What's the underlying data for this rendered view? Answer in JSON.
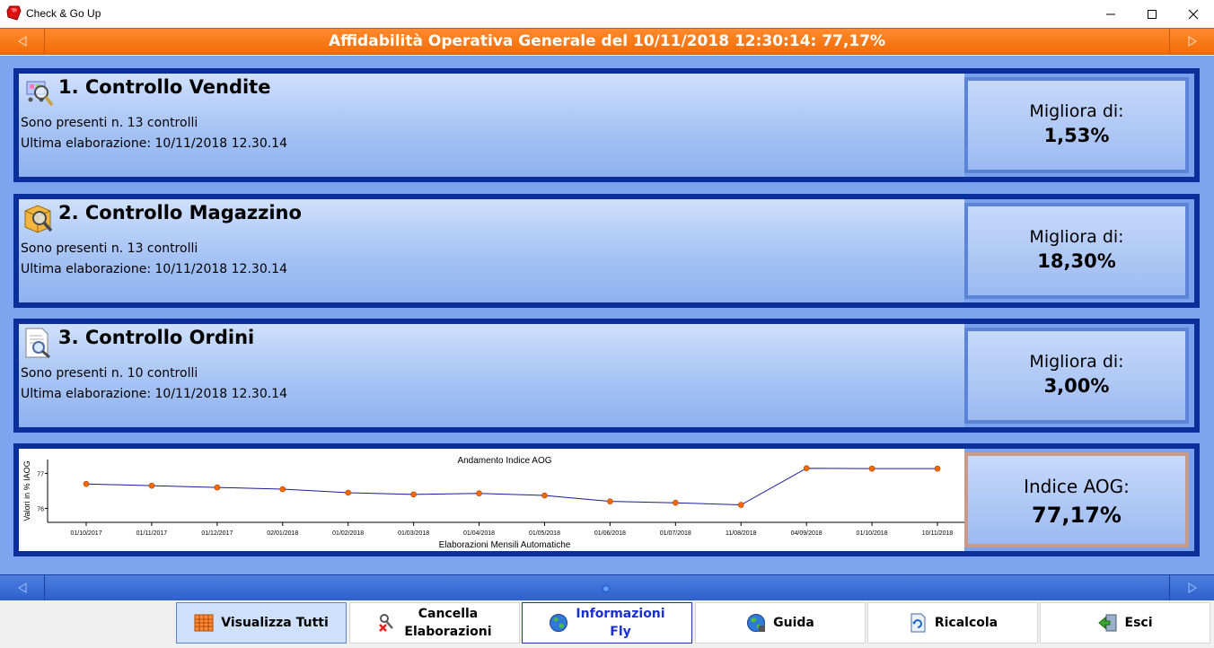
{
  "window": {
    "title": "Check & Go Up"
  },
  "banner": {
    "text": "Affidabilità Operativa Generale del 10/11/2018 12:30:14: 77,17%"
  },
  "panels": [
    {
      "title": "1. Controllo Vendite",
      "count_text": "Sono presenti n. 13 controlli",
      "last_text": "Ultima elaborazione: 10/11/2018 12.30.14",
      "score_label": "Migliora di:",
      "score_value": "1,53%",
      "icon": "cart-magnifier-icon"
    },
    {
      "title": "2. Controllo Magazzino",
      "count_text": "Sono presenti n. 13 controlli",
      "last_text": "Ultima elaborazione: 10/11/2018 12.30.14",
      "score_label": "Migliora di:",
      "score_value": "18,30%",
      "icon": "box-magnifier-icon"
    },
    {
      "title": "3. Controllo Ordini",
      "count_text": "Sono presenti n. 10 controlli",
      "last_text": "Ultima elaborazione: 10/11/2018 12.30.14",
      "score_label": "Migliora di:",
      "score_value": "3,00%",
      "icon": "document-magnifier-icon"
    }
  ],
  "aog": {
    "label": "Indice AOG:",
    "value": "77,17%"
  },
  "chart_data": {
    "type": "line",
    "title": "Andamento Indice AOG",
    "xlabel": "Elaborazioni Mensili Automatiche",
    "ylabel": "Valori in % IAOG",
    "categories": [
      "01/10/2017",
      "01/11/2017",
      "01/12/2017",
      "02/01/2018",
      "01/02/2018",
      "01/03/2018",
      "01/04/2018",
      "01/05/2018",
      "01/06/2018",
      "01/07/2018",
      "11/08/2018",
      "04/09/2018",
      "01/10/2018",
      "10/11/2018"
    ],
    "yticks": [
      76,
      77
    ],
    "ylim": [
      75.6,
      77.4
    ],
    "series": [
      {
        "values": [
          76.7,
          76.65,
          76.6,
          76.55,
          76.45,
          76.4,
          76.43,
          76.37,
          76.2,
          76.16,
          76.1,
          77.15,
          77.14,
          77.14
        ]
      }
    ],
    "line_color": "#1a1a9a",
    "marker_color": "#ff6a00",
    "grid": false
  },
  "toolbar": [
    {
      "label": "Visualizza Tutti",
      "icon": "calendar-grid-icon",
      "state": "active"
    },
    {
      "label": "Cancella\nElaborazioni",
      "icon": "clear-tools-icon",
      "state": "normal"
    },
    {
      "label": "Informazioni\nFly",
      "icon": "globe-icon",
      "state": "selected"
    },
    {
      "label": "Guida",
      "icon": "globe-help-icon",
      "state": "normal"
    },
    {
      "label": "Ricalcola",
      "icon": "refresh-document-icon",
      "state": "normal"
    },
    {
      "label": "Esci",
      "icon": "exit-door-icon",
      "state": "normal"
    }
  ]
}
